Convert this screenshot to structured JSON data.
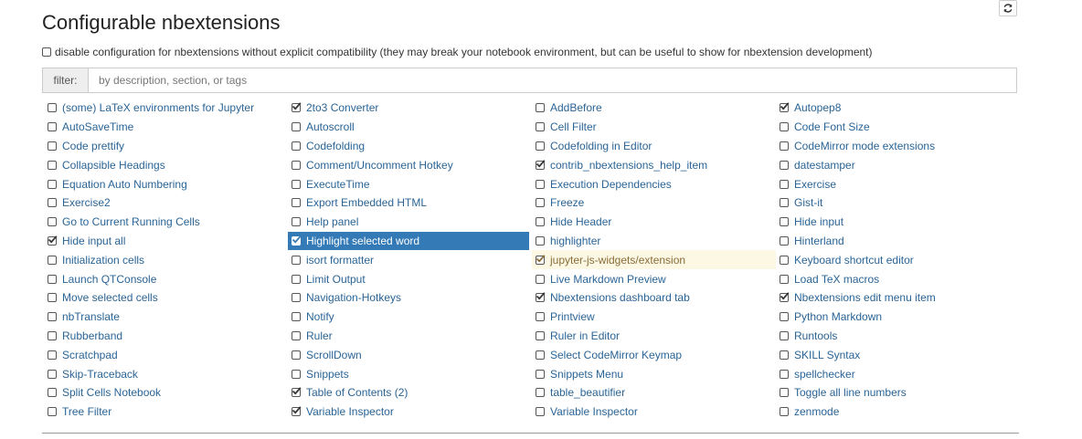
{
  "header": {
    "title": "Configurable nbextensions",
    "refresh_icon": "refresh-icon"
  },
  "compat": {
    "label": "disable configuration for nbextensions without explicit compatibility (they may break your notebook environment, but can be useful to show for nbextension development)",
    "checked": false
  },
  "filter": {
    "label": "filter:",
    "placeholder": "by description, section, or tags",
    "value": ""
  },
  "extensions": [
    [
      {
        "label": "(some) LaTeX environments for Jupyter",
        "checked": false
      },
      {
        "label": "AutoSaveTime",
        "checked": false
      },
      {
        "label": "Code prettify",
        "checked": false
      },
      {
        "label": "Collapsible Headings",
        "checked": false
      },
      {
        "label": "Equation Auto Numbering",
        "checked": false
      },
      {
        "label": "Exercise2",
        "checked": false
      },
      {
        "label": "Go to Current Running Cells",
        "checked": false
      },
      {
        "label": "Hide input all",
        "checked": true
      },
      {
        "label": "Initialization cells",
        "checked": false
      },
      {
        "label": "Launch QTConsole",
        "checked": false
      },
      {
        "label": "Move selected cells",
        "checked": false
      },
      {
        "label": "nbTranslate",
        "checked": false
      },
      {
        "label": "Rubberband",
        "checked": false
      },
      {
        "label": "Scratchpad",
        "checked": false
      },
      {
        "label": "Skip-Traceback",
        "checked": false
      },
      {
        "label": "Split Cells Notebook",
        "checked": false
      },
      {
        "label": "Tree Filter",
        "checked": false
      }
    ],
    [
      {
        "label": "2to3 Converter",
        "checked": true
      },
      {
        "label": "Autoscroll",
        "checked": false
      },
      {
        "label": "Codefolding",
        "checked": false
      },
      {
        "label": "Comment/Uncomment Hotkey",
        "checked": false
      },
      {
        "label": "ExecuteTime",
        "checked": false
      },
      {
        "label": "Export Embedded HTML",
        "checked": false
      },
      {
        "label": "Help panel",
        "checked": false
      },
      {
        "label": "Highlight selected word",
        "checked": true,
        "state": "selected"
      },
      {
        "label": "isort formatter",
        "checked": false
      },
      {
        "label": "Limit Output",
        "checked": false
      },
      {
        "label": "Navigation-Hotkeys",
        "checked": false
      },
      {
        "label": "Notify",
        "checked": false
      },
      {
        "label": "Ruler",
        "checked": false
      },
      {
        "label": "ScrollDown",
        "checked": false
      },
      {
        "label": "Snippets",
        "checked": false
      },
      {
        "label": "Table of Contents (2)",
        "checked": true
      },
      {
        "label": "Variable Inspector",
        "checked": true
      }
    ],
    [
      {
        "label": "AddBefore",
        "checked": false
      },
      {
        "label": "Cell Filter",
        "checked": false
      },
      {
        "label": "Codefolding in Editor",
        "checked": false
      },
      {
        "label": "contrib_nbextensions_help_item",
        "checked": true
      },
      {
        "label": "Execution Dependencies",
        "checked": false
      },
      {
        "label": "Freeze",
        "checked": false
      },
      {
        "label": "Hide Header",
        "checked": false
      },
      {
        "label": "highlighter",
        "checked": false
      },
      {
        "label": "jupyter-js-widgets/extension",
        "checked": true,
        "state": "incompatible"
      },
      {
        "label": "Live Markdown Preview",
        "checked": false
      },
      {
        "label": "Nbextensions dashboard tab",
        "checked": true
      },
      {
        "label": "Printview",
        "checked": false
      },
      {
        "label": "Ruler in Editor",
        "checked": false
      },
      {
        "label": "Select CodeMirror Keymap",
        "checked": false
      },
      {
        "label": "Snippets Menu",
        "checked": false
      },
      {
        "label": "table_beautifier",
        "checked": false
      },
      {
        "label": "Variable Inspector",
        "checked": false
      }
    ],
    [
      {
        "label": "Autopep8",
        "checked": true
      },
      {
        "label": "Code Font Size",
        "checked": false
      },
      {
        "label": "CodeMirror mode extensions",
        "checked": false
      },
      {
        "label": "datestamper",
        "checked": false
      },
      {
        "label": "Exercise",
        "checked": false
      },
      {
        "label": "Gist-it",
        "checked": false
      },
      {
        "label": "Hide input",
        "checked": false
      },
      {
        "label": "Hinterland",
        "checked": false
      },
      {
        "label": "Keyboard shortcut editor",
        "checked": false
      },
      {
        "label": "Load TeX macros",
        "checked": false
      },
      {
        "label": "Nbextensions edit menu item",
        "checked": true
      },
      {
        "label": "Python Markdown",
        "checked": false
      },
      {
        "label": "Runtools",
        "checked": false
      },
      {
        "label": "SKILL Syntax",
        "checked": false
      },
      {
        "label": "spellchecker",
        "checked": false
      },
      {
        "label": "Toggle all line numbers",
        "checked": false
      },
      {
        "label": "zenmode",
        "checked": false
      }
    ]
  ]
}
